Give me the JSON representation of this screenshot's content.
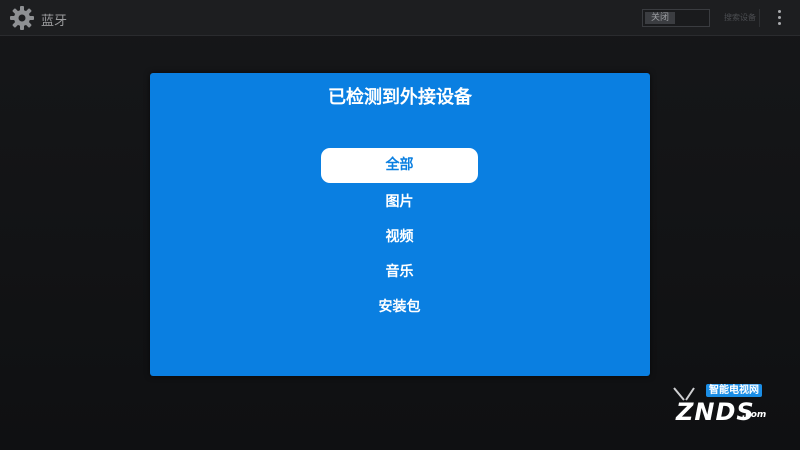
{
  "topbar": {
    "app_title": "蓝牙",
    "toggle_label": "关闭",
    "scan_label": "搜索设备"
  },
  "dialog": {
    "title": "已检测到外接设备",
    "options": [
      {
        "label": "全部",
        "selected": true
      },
      {
        "label": "图片",
        "selected": false
      },
      {
        "label": "视频",
        "selected": false
      },
      {
        "label": "音乐",
        "selected": false
      },
      {
        "label": "安装包",
        "selected": false
      }
    ]
  },
  "watermark": {
    "tagline": "智能电视网",
    "brand": "ZNDS",
    "suffix": ".com"
  },
  "colors": {
    "dialog_bg": "#0a7fe1",
    "selected_bg": "#ffffff",
    "background": "#111214"
  },
  "icons": {
    "app": "gear-icon",
    "menu": "overflow-menu-icon"
  }
}
